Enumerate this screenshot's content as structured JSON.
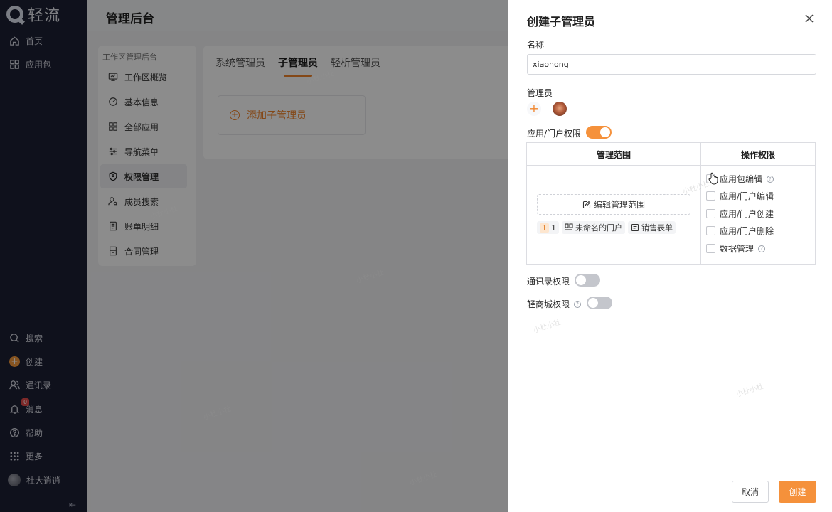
{
  "sidebar": {
    "logo_text": "轻流",
    "items": [
      {
        "label": "首页",
        "icon": "home-icon"
      },
      {
        "label": "应用包",
        "icon": "apps-icon"
      }
    ],
    "bottom_items": [
      {
        "label": "搜索",
        "icon": "search-icon"
      },
      {
        "label": "创建",
        "icon": "create-icon"
      },
      {
        "label": "通讯录",
        "icon": "contacts-icon"
      },
      {
        "label": "消息",
        "icon": "bell-icon",
        "badge": "0"
      },
      {
        "label": "帮助",
        "icon": "help-icon"
      },
      {
        "label": "更多",
        "icon": "grid-icon"
      },
      {
        "label": "杜大逍逍",
        "icon": "avatar"
      }
    ],
    "collapse": "⇤"
  },
  "main": {
    "title": "管理后台",
    "subnav_head": "工作区管理后台",
    "subnav": [
      {
        "label": "工作区概览",
        "icon": "monitor-icon"
      },
      {
        "label": "基本信息",
        "icon": "gauge-icon"
      },
      {
        "label": "全部应用",
        "icon": "apps-icon"
      },
      {
        "label": "导航菜单",
        "icon": "sliders-icon"
      },
      {
        "label": "权限管理",
        "icon": "shield-icon",
        "active": true
      },
      {
        "label": "成员搜索",
        "icon": "user-search-icon"
      },
      {
        "label": "账单明细",
        "icon": "bill-icon"
      },
      {
        "label": "合同管理",
        "icon": "contract-icon"
      }
    ],
    "tabs": [
      {
        "label": "系统管理员"
      },
      {
        "label": "子管理员",
        "active": true
      },
      {
        "label": "轻析管理员"
      }
    ],
    "add_admin": "添加子管理员",
    "watermark": "小杜小杜"
  },
  "drawer": {
    "title": "创建子管理员",
    "name_label": "名称",
    "name_value": "xiaohong",
    "admin_label": "管理员",
    "app_perm_label": "应用/门户权限",
    "app_perm_on": true,
    "table": {
      "col_scope": "管理范围",
      "col_ops": "操作权限",
      "edit_scope": "编辑管理范围",
      "chips": {
        "count_badge": "1",
        "count": "1",
        "portal": "未命名的门户",
        "form": "销售表单"
      },
      "ops": [
        {
          "label": "应用包编辑",
          "help": true
        },
        {
          "label": "应用/门户编辑",
          "help": false
        },
        {
          "label": "应用/门户创建",
          "help": false
        },
        {
          "label": "应用/门户删除",
          "help": false
        },
        {
          "label": "数据管理",
          "help": true
        }
      ]
    },
    "contacts_perm_label": "通讯录权限",
    "contacts_perm_on": false,
    "mall_perm_label": "轻商城权限",
    "mall_perm_on": false,
    "cancel": "取消",
    "create": "创建"
  },
  "colors": {
    "accent": "#f5913b",
    "sidebar_bg": "#1d2033"
  }
}
